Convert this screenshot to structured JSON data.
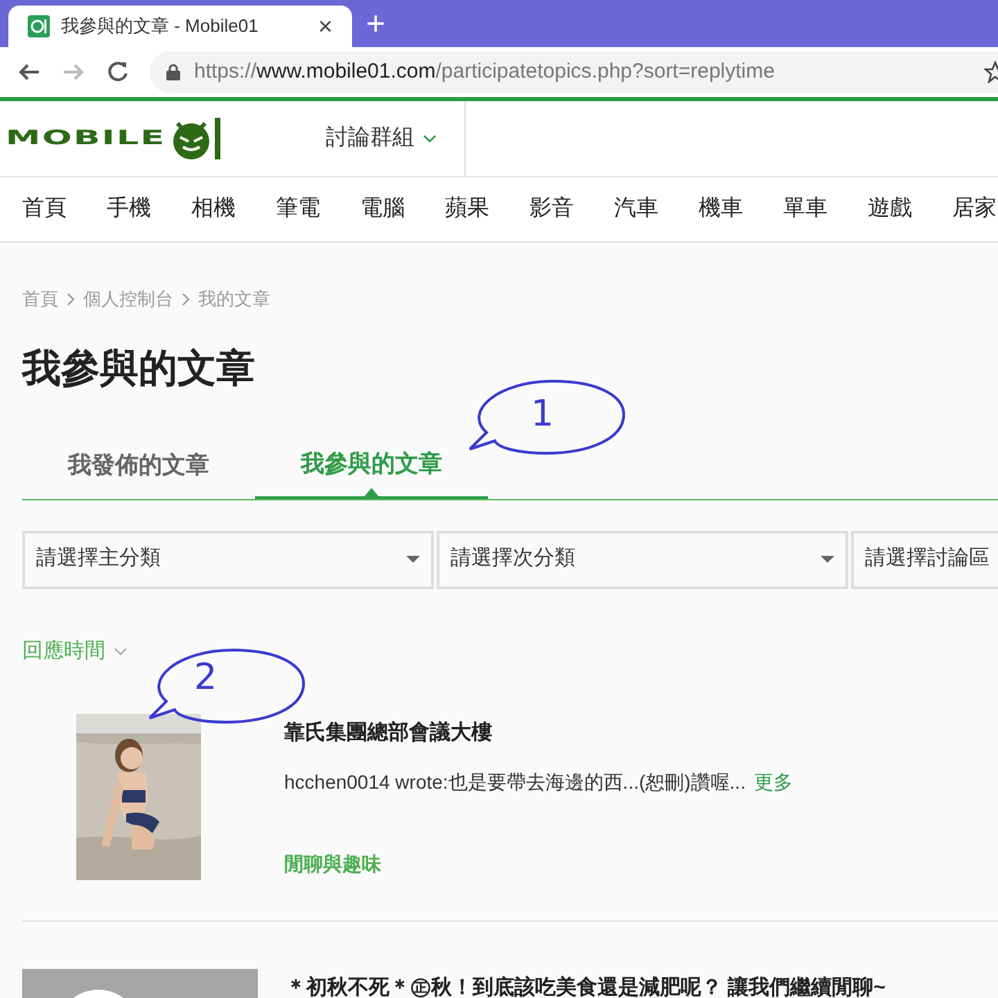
{
  "browser": {
    "tab_title": "我參與的文章 - Mobile01",
    "tab_close": "×",
    "new_tab": "+",
    "url": {
      "scheme": "https://",
      "host": "www.mobile01.com",
      "path": "/participatetopics.php?sort=replytime"
    }
  },
  "header": {
    "logo_text": "MOBILE",
    "menu": "討論群組"
  },
  "nav": [
    "首頁",
    "手機",
    "相機",
    "筆電",
    "電腦",
    "蘋果",
    "影音",
    "汽車",
    "機車",
    "單車",
    "遊戲",
    "居家"
  ],
  "breadcrumb": [
    "首頁",
    "個人控制台",
    "我的文章"
  ],
  "title": "我參與的文章",
  "tabs": [
    {
      "label": "我發佈的文章",
      "selected": false
    },
    {
      "label": "我參與的文章",
      "selected": true
    }
  ],
  "filters": [
    "請選擇主分類",
    "請選擇次分類",
    "請選擇討論區"
  ],
  "sort": "回應時間",
  "callouts": [
    {
      "number": "1"
    },
    {
      "number": "2"
    }
  ],
  "posts": [
    {
      "title": "靠氏集團總部會議大樓",
      "excerpt": "hcchen0014 wrote:也是要帶去海邊的西...(恕刪)讚喔...",
      "more": "更多",
      "category": "閒聊與趣味"
    },
    {
      "thumbnail": {
        "kind": "placeholder"
      },
      "title": "＊初秋不死＊㊣秋！到底該吃美食還是減肥呢？ 讓我們繼續閒聊~"
    }
  ]
}
